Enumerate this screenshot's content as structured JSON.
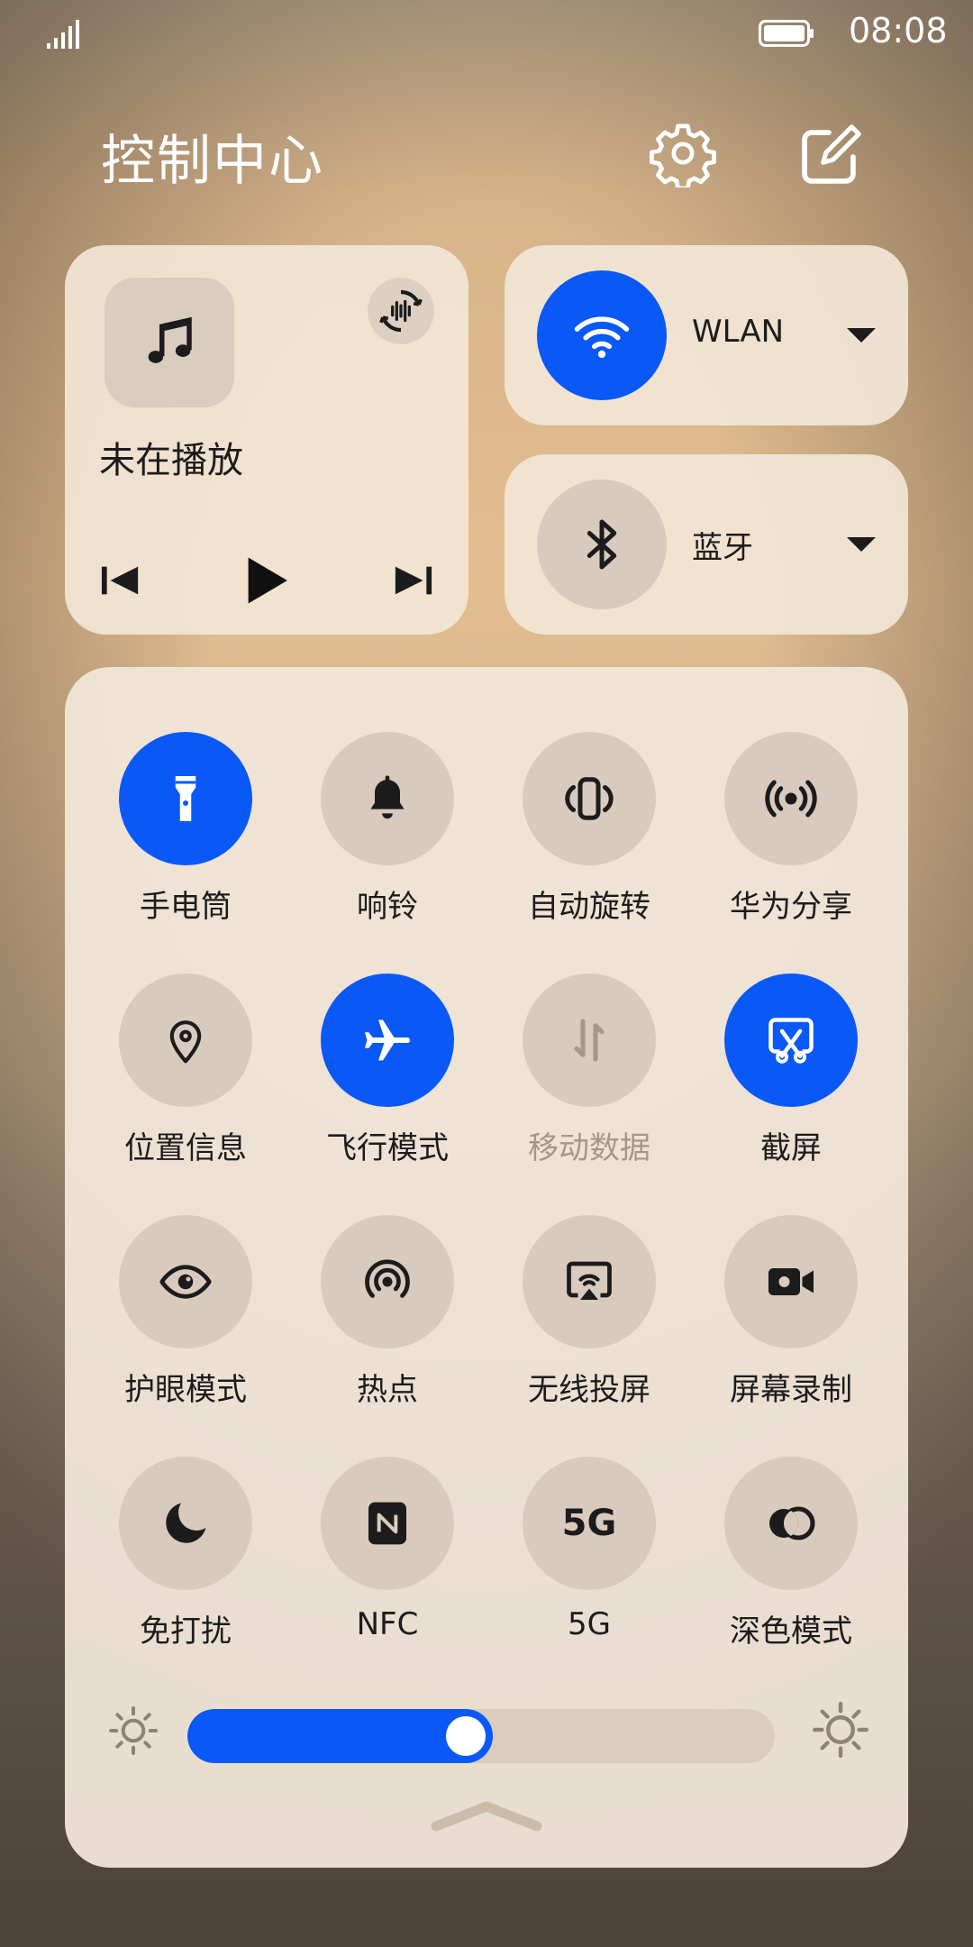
{
  "status_bar": {
    "time": "08:08",
    "battery_icon": "battery-full-icon",
    "signal_icon": "signal-icon"
  },
  "header": {
    "title": "控制中心",
    "settings_icon": "gear-icon",
    "edit_icon": "edit-icon"
  },
  "media": {
    "status": "未在播放",
    "icons": [
      "music-note-icon",
      "audio-output-icon",
      "previous-icon",
      "play-icon",
      "next-icon"
    ]
  },
  "wlan": {
    "label": "WLAN",
    "on": true
  },
  "bluetooth": {
    "label": "蓝牙",
    "on": false
  },
  "toggles": [
    {
      "label": "手电筒",
      "icon": "flashlight-icon",
      "on": true
    },
    {
      "label": "响铃",
      "icon": "bell-icon",
      "on": false
    },
    {
      "label": "自动旋转",
      "icon": "auto-rotate-icon",
      "on": false
    },
    {
      "label": "华为分享",
      "icon": "huawei-share-icon",
      "on": false
    },
    {
      "label": "位置信息",
      "icon": "location-icon",
      "on": false
    },
    {
      "label": "飞行模式",
      "icon": "airplane-icon",
      "on": true
    },
    {
      "label": "移动数据",
      "icon": "mobile-data-icon",
      "on": false,
      "disabled": true
    },
    {
      "label": "截屏",
      "icon": "screenshot-icon",
      "on": true
    },
    {
      "label": "护眼模式",
      "icon": "eye-icon",
      "on": false
    },
    {
      "label": "热点",
      "icon": "hotspot-icon",
      "on": false
    },
    {
      "label": "无线投屏",
      "icon": "wireless-projection-icon",
      "on": false
    },
    {
      "label": "屏幕录制",
      "icon": "screen-record-icon",
      "on": false
    },
    {
      "label": "免打扰",
      "icon": "moon-icon",
      "on": false
    },
    {
      "label": "NFC",
      "icon": "nfc-icon",
      "on": false
    },
    {
      "label": "5G",
      "icon": "5g-icon",
      "icon_text": "5G",
      "on": false
    },
    {
      "label": "深色模式",
      "icon": "dark-mode-icon",
      "on": false
    }
  ],
  "brightness": {
    "level": 0.52,
    "low_icon": "sun-small-icon",
    "high_icon": "sun-large-icon"
  },
  "colors": {
    "accent": "#0a59f7",
    "tile_off": "#d8cbbd",
    "card": "#f2e6d6"
  }
}
